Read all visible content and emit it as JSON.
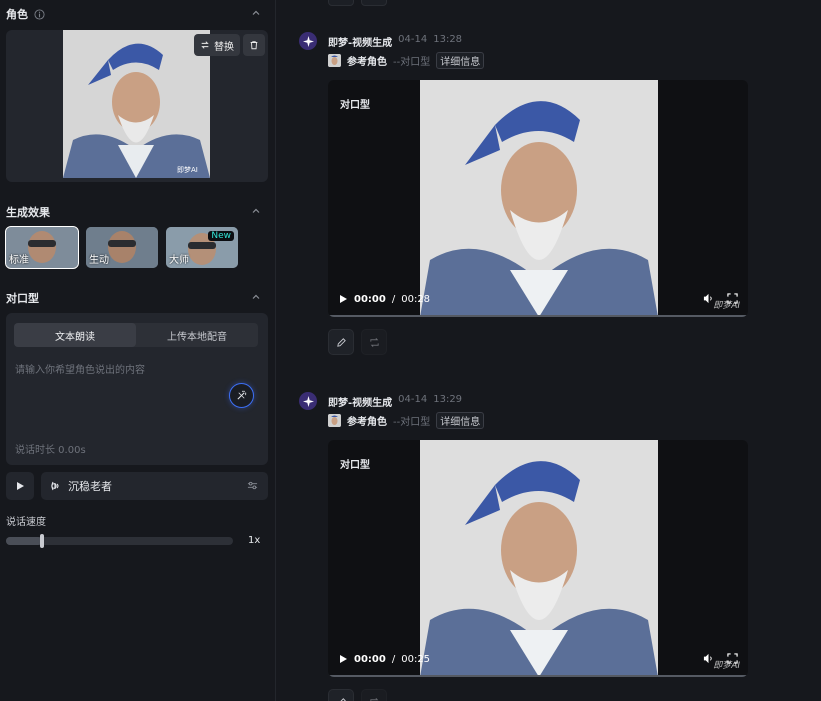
{
  "left": {
    "role": {
      "title": "角色",
      "replace_label": "替换"
    },
    "effects": {
      "title": "生成效果",
      "items": [
        {
          "label": "标准",
          "selected": true
        },
        {
          "label": "生动",
          "selected": false
        },
        {
          "label": "大师",
          "selected": false,
          "badge": "New"
        }
      ]
    },
    "lipsync": {
      "title": "对口型",
      "tabs": [
        "文本朗读",
        "上传本地配音"
      ],
      "active_tab": 0,
      "placeholder": "请输入你希望角色说出的内容",
      "duration": "说话时长 0.00s"
    },
    "voice": {
      "name": "沉稳老者"
    },
    "speed": {
      "label": "说话速度",
      "value_text": "1x",
      "fraction": 0.16
    }
  },
  "feed": {
    "entries": [
      {
        "title": "即梦-视频生成",
        "date": "04-14",
        "time": "13:28",
        "ref_label": "参考角色",
        "mode": "--对口型",
        "detail_label": "详细信息",
        "video_label": "对口型",
        "current_time": "00:00",
        "separator": "/",
        "duration_partial": "00:28",
        "watermark": "即梦AI"
      },
      {
        "title": "即梦-视频生成",
        "date": "04-14",
        "time": "13:29",
        "ref_label": "参考角色",
        "mode": "--对口型",
        "detail_label": "详细信息",
        "video_label": "对口型",
        "current_time": "00:00",
        "separator": "/",
        "duration_partial": "00:25",
        "watermark": "即梦AI"
      }
    ]
  },
  "colors": {
    "bg": "#16181d",
    "panel": "#23262d",
    "accent": "#3d6ff5",
    "badge_text": "#32e3d6"
  }
}
